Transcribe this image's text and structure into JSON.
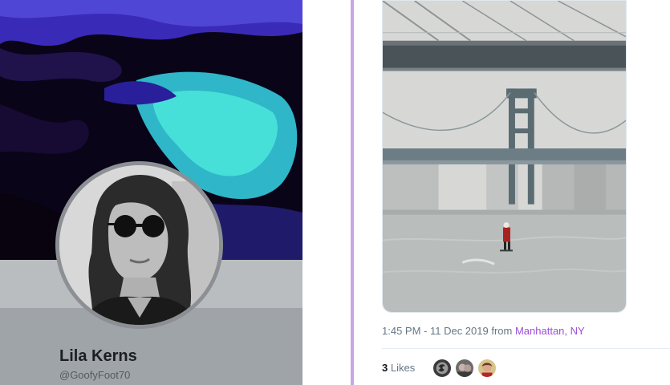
{
  "profile": {
    "name": "Lila Kerns",
    "handle": "@GoofyFoot70"
  },
  "tweet": {
    "timestamp": "1:45 PM - 11 Dec 2019 from",
    "place": "Manhattan, NY",
    "likes_count": "3",
    "likes_label": "Likes"
  },
  "colors": {
    "accent": "#c9a6e8",
    "place_link": "#9d4fd6",
    "meta_text": "#657786"
  }
}
